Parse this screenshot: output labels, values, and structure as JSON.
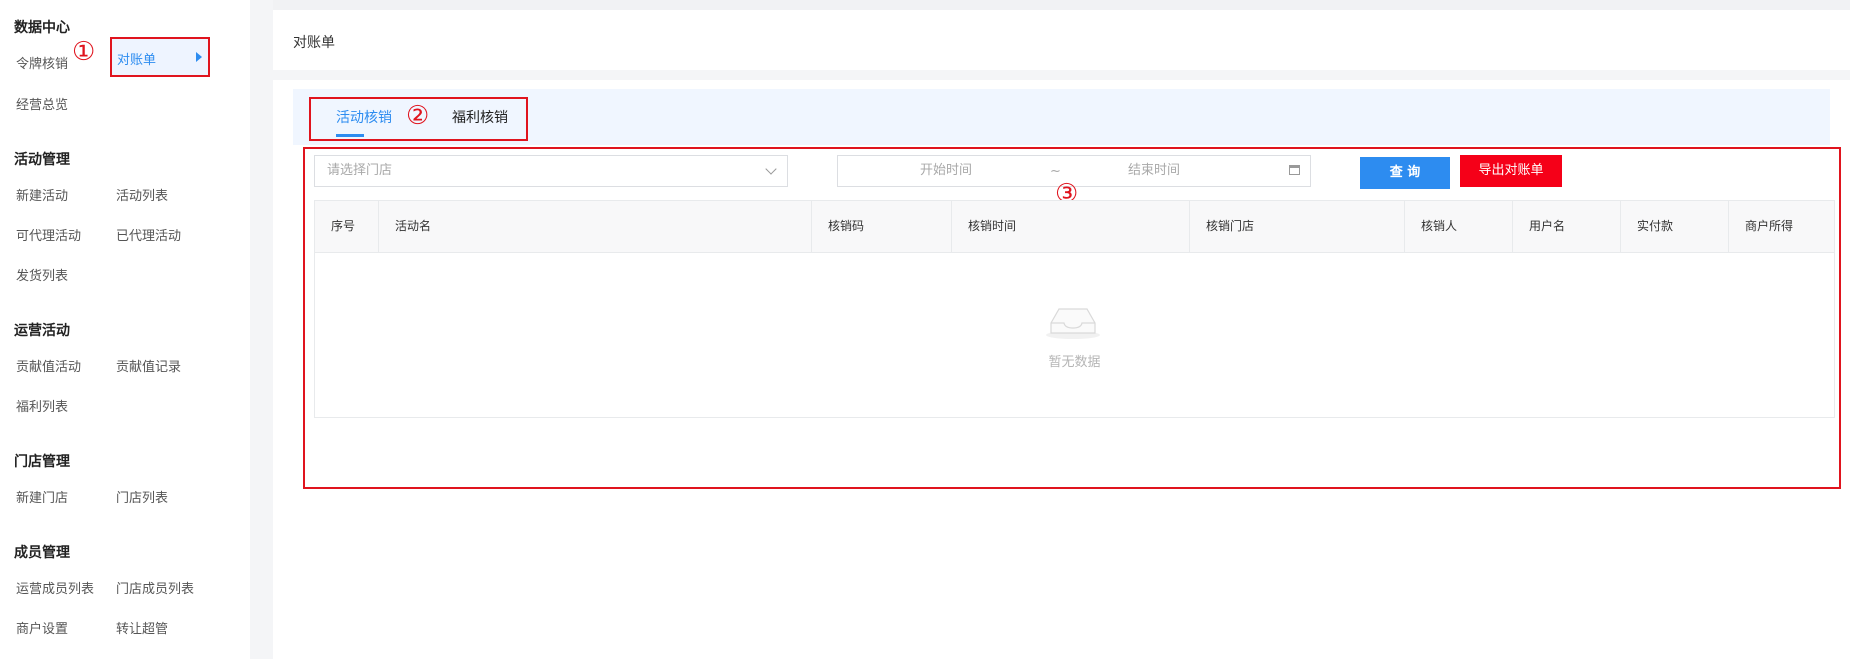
{
  "sidebar": {
    "groups": [
      {
        "title": "数据中心",
        "items": [
          "令牌核销",
          "对账单",
          "经营总览"
        ]
      },
      {
        "title": "活动管理",
        "items": [
          "新建活动",
          "活动列表",
          "可代理活动",
          "已代理活动",
          "发货列表"
        ]
      },
      {
        "title": "运营活动",
        "items": [
          "贡献值活动",
          "贡献值记录",
          "福利列表"
        ]
      },
      {
        "title": "门店管理",
        "items": [
          "新建门店",
          "门店列表"
        ]
      },
      {
        "title": "成员管理",
        "items": [
          "运营成员列表",
          "门店成员列表",
          "商户设置",
          "转让超管"
        ]
      }
    ],
    "active_item": "对账单"
  },
  "annotations": {
    "one": "①",
    "two": "②",
    "three": "③"
  },
  "page": {
    "title": "对账单"
  },
  "tabs": [
    {
      "label": "活动核销",
      "active": true
    },
    {
      "label": "福利核销",
      "active": false
    }
  ],
  "filters": {
    "store_placeholder": "请选择门店",
    "start_placeholder": "开始时间",
    "range_sep": "~",
    "end_placeholder": "结束时间",
    "query_label": "查 询",
    "export_label": "导出对账单"
  },
  "table": {
    "columns": [
      "序号",
      "活动名",
      "核销码",
      "核销时间",
      "核销门店",
      "核销人",
      "用户名",
      "实付款",
      "商户所得"
    ],
    "empty_text": "暂无数据"
  },
  "colors": {
    "accent": "#2d8cf0",
    "export_button": "#f50018",
    "annotation": "#e0141e"
  }
}
